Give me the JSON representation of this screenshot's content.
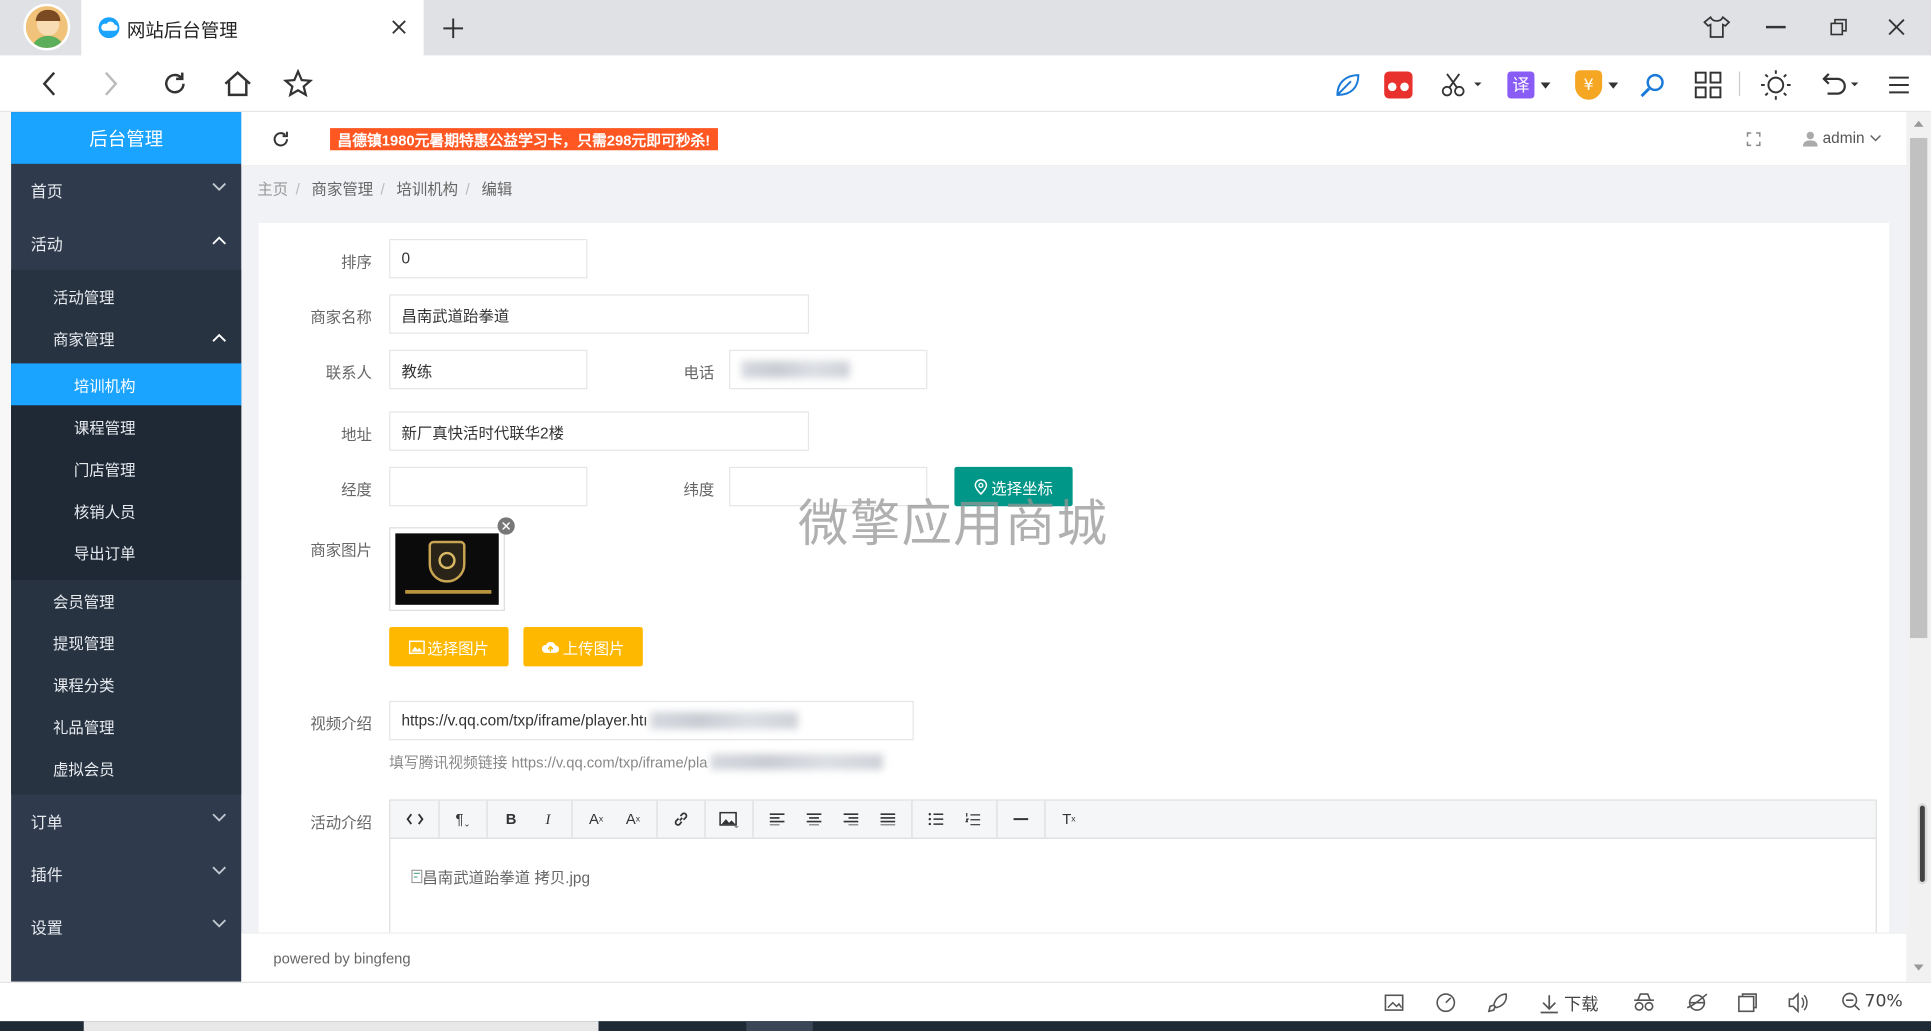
{
  "browser": {
    "tab_title": "网站后台管理",
    "zoom": "70%",
    "download_label": "下载"
  },
  "sidebar": {
    "title": "后台管理",
    "items": [
      {
        "label": "首页",
        "expanded": false
      },
      {
        "label": "活动",
        "expanded": true
      },
      {
        "label": "订单",
        "expanded": false
      },
      {
        "label": "插件",
        "expanded": false
      },
      {
        "label": "设置",
        "expanded": false
      }
    ],
    "activity_sub": [
      "活动管理",
      "商家管理",
      "会员管理",
      "提现管理",
      "课程分类",
      "礼品管理",
      "虚拟会员"
    ],
    "merchant_sub": [
      "培训机构",
      "课程管理",
      "门店管理",
      "核销人员",
      "导出订单"
    ],
    "active_item": "培训机构"
  },
  "header": {
    "promo": "昌德镇1980元暑期特惠公益学习卡，只需298元即可秒杀!",
    "user": "admin"
  },
  "breadcrumb": [
    "主页",
    "商家管理",
    "培训机构",
    "编辑"
  ],
  "form": {
    "sort_label": "排序",
    "sort_value": "0",
    "name_label": "商家名称",
    "name_value": "昌南武道跆拳道",
    "contact_label": "联系人",
    "contact_value": "教练",
    "phone_label": "电话",
    "address_label": "地址",
    "address_value": "新厂真快活时代联华2楼",
    "lng_label": "经度",
    "lat_label": "纬度",
    "pick_coord": "选择坐标",
    "image_label": "商家图片",
    "choose_image": "选择图片",
    "upload_image": "上传图片",
    "video_label": "视频介绍",
    "video_value": "https://v.qq.com/txp/iframe/player.htı",
    "video_hint": "填写腾讯视频链接 https://v.qq.com/txp/iframe/pla",
    "intro_label": "活动介绍",
    "editor_image_alt": "昌南武道跆拳道 拷贝.jpg"
  },
  "editor_tools": [
    "<>",
    "¶",
    "B",
    "I",
    "A",
    "A₂",
    "link",
    "image",
    "align-left",
    "align-center",
    "align-right",
    "justify",
    "ul",
    "ol",
    "—",
    "Tx"
  ],
  "footer": "powered by bingfeng",
  "watermark": "微擎应用商城",
  "colors": {
    "sidebar": "#2f3b4c",
    "accent": "#1aa3ff",
    "yellow": "#ffb800",
    "teal": "#009688",
    "promo": "#ff5722"
  }
}
